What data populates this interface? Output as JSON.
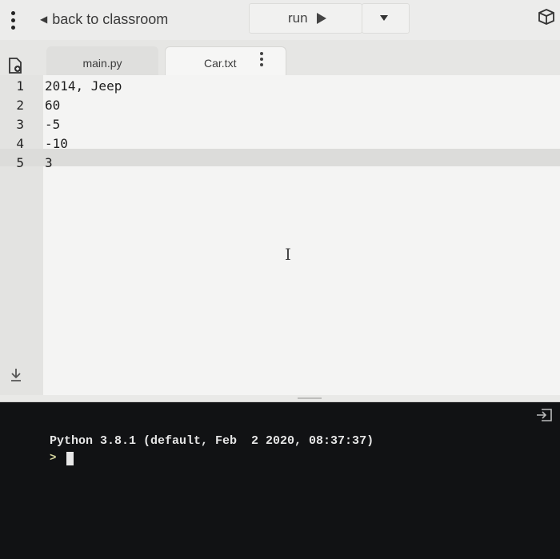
{
  "topbar": {
    "back_label": "back to classroom",
    "run_label": "run"
  },
  "tabs": [
    {
      "label": "main.py"
    },
    {
      "label": "Car.txt"
    }
  ],
  "editor": {
    "lines": [
      {
        "num": "1",
        "text": "2014, Jeep"
      },
      {
        "num": "2",
        "text": "60"
      },
      {
        "num": "3",
        "text": "-5"
      },
      {
        "num": "4",
        "text": "-10"
      },
      {
        "num": "5",
        "text": "3"
      }
    ],
    "active_line": 5
  },
  "console": {
    "banner": "Python 3.8.1 (default, Feb  2 2020, 08:37:37)",
    "prompt": ">"
  },
  "icons": {
    "menu": "kebab-menu-icon",
    "back": "caret-left-icon",
    "run": "play-icon",
    "dropdown": "chevron-down-icon",
    "box": "package-icon",
    "file": "file-icon",
    "download": "download-icon",
    "exit": "exit-icon"
  }
}
